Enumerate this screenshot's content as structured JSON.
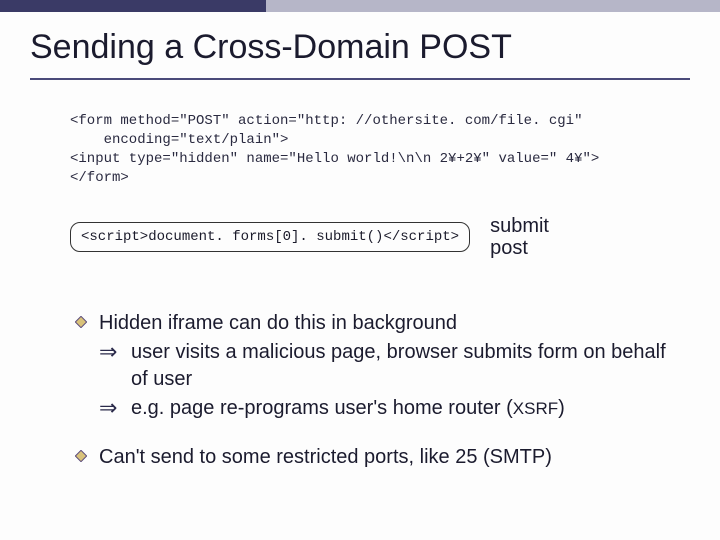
{
  "header": {
    "title": "Sending a Cross-Domain POST"
  },
  "code": {
    "block": "<form method=\"POST\" action=\"http: //othersite. com/file. cgi\"\n    encoding=\"text/plain\">\n<input type=\"hidden\" name=\"Hello world!\\n\\n 2¥+2¥\" value=\" 4¥\">\n</form>",
    "script_line": "<script>document. forms[0]. submit()</scr",
    "script_tail": "ipt>",
    "script_label_line1": "submit",
    "script_label_line2": "post"
  },
  "bullets": {
    "b1": "Hidden iframe can do this in background",
    "b1s1": " user visits a malicious page, browser submits form on behalf of user",
    "b1s2_a": " e.g.  page re-programs user's home router  (",
    "b1s2_b": "XSRF",
    "b1s2_c": ")",
    "b2": "Can't send to some restricted ports, like 25 (SMTP)"
  }
}
